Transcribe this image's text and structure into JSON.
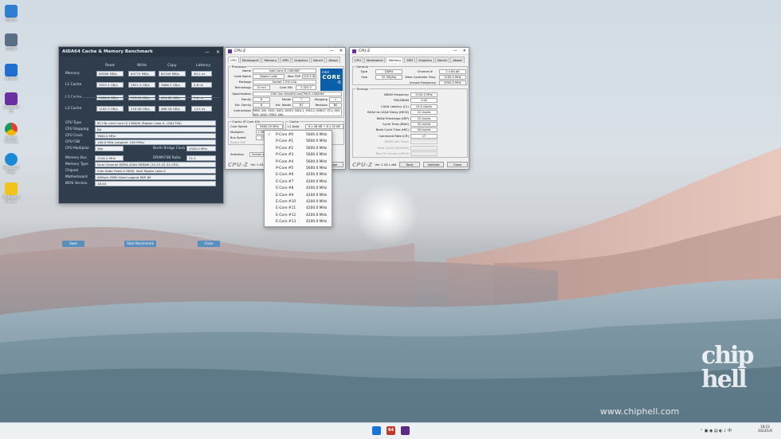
{
  "desktop": {
    "icons": [
      {
        "label": "回收站",
        "color": "#2f7fd1"
      },
      {
        "label": "此电脑",
        "color": "#5b6f86"
      },
      {
        "label": "AIDA64",
        "color": "#1e6fd0"
      },
      {
        "label": "CPU-Z 64位",
        "color": "#6a2fa0"
      },
      {
        "label": "Google Chrome",
        "color": "#e8a21f"
      },
      {
        "label": "Microsoft Edge",
        "color": "#1d8ad6"
      },
      {
        "label": "Thaiphoon Burner",
        "color": "#f0c419"
      }
    ]
  },
  "aida": {
    "title": "AIDA64 Cache & Memory Benchmark",
    "controls": {
      "minimize": "—",
      "close": "✕"
    },
    "cols": [
      "Read",
      "Write",
      "Copy",
      "Latency"
    ],
    "rows": [
      {
        "label": "Memory",
        "values": [
          "69280 MB/s",
          "64775 MB/s",
          "65190 MB/s",
          "90.2 ns"
        ]
      },
      {
        "label": "L1 Cache",
        "values": [
          "3933.4 GB/s",
          "2851.0 GB/s",
          "5686.5 GB/s",
          "0.8 ns"
        ]
      },
      {
        "label": "L2 Cache",
        "values": [
          "1060.0 GB/s",
          "393.20 GB/s",
          "694.82 GB/s",
          "3.6 ns"
        ]
      },
      {
        "label": "L3 Cache",
        "values": [
          "1165.3 GB/s",
          "516.08 GB/s",
          "668.56 GB/s",
          "14.5 ns"
        ]
      }
    ],
    "info": [
      {
        "label": "CPU Type",
        "value": "8C+8c Intel Core i5-13600K (Raptor Lake-S, LGA1700)"
      },
      {
        "label": "CPU Stepping",
        "value": "B0"
      },
      {
        "label": "CPU Clock",
        "value": "5600.0 MHz"
      },
      {
        "label": "CPU FSB",
        "value": "100.0 MHz (original: 100 MHz)"
      },
      {
        "label": "CPU Multiplier",
        "value": "56x",
        "extra_label": "North Bridge Clock",
        "extra_value": "4500.0 MHz"
      }
    ],
    "mem": [
      {
        "label": "Memory Bus",
        "value": "2100.0 MHz",
        "extra_label": "DRAM:FSB Ratio",
        "extra_value": "21:1"
      },
      {
        "label": "Memory Type",
        "value": "Dual Channel DDR4-4200 SDRAM (19-22-22-32 CR1)"
      },
      {
        "label": "Chipset",
        "value": "Intel Alder Point-S Z690, Intel Raptor Lake-S"
      },
      {
        "label": "Motherboard",
        "value": "ASRock Z690 Steel Legend WiFi 6E"
      },
      {
        "label": "BIOS Version",
        "value": "16.04"
      }
    ],
    "footer": "AIDA64 v6.80.6200 / BenchDLL 4.6.875.8-x64 (c) 1995-2022 FinalWire Ltd.",
    "buttons": {
      "save": "Save",
      "start": "Start Benchmark",
      "close": "Close"
    }
  },
  "cpuz1": {
    "title": "CPU-Z",
    "controls": {
      "minimize": "—",
      "close": "✕"
    },
    "tabs": [
      "CPU",
      "Mainboard",
      "Memory",
      "SPD",
      "Graphics",
      "Bench",
      "About"
    ],
    "processor_title": "Processor",
    "name_label": "Name",
    "name": "Intel Core i5 13600KF",
    "codename_label": "Code Name",
    "codename": "Raptor Lake",
    "maxtdp_label": "Max TDP",
    "maxtdp": "125.0 W",
    "package_label": "Package",
    "package": "Socket 1700 LGA",
    "tech_label": "Technology",
    "tech": "10 nm",
    "corevid_label": "Core VID",
    "corevid": "1.323 V",
    "spec_label": "Specification",
    "spec": "13th Gen Intel(R)Core(TM)i5-13600KF",
    "family_label": "Family",
    "family": "6",
    "model_label": "Model",
    "model": "7",
    "stepping_label": "Stepping",
    "stepping": "1",
    "extfam_label": "Ext. Family",
    "extfam": "6",
    "extmodel_label": "Ext. Model",
    "extmodel": "B7",
    "revision_label": "Revision",
    "revision": "B0",
    "instr_label": "Instructions",
    "instr": "MMX, SSE, SSE2, SSE3, SSSE3, SSE4.1, SSE4.2, EM64T, VT-x, AES, AVX, AVX2, FMA3, SHA",
    "logo": {
      "brand": "intel",
      "core": "CORE",
      "tier": "i5"
    },
    "clocks_title": "Clocks (P-Core #0)",
    "cache_title": "Cache",
    "corespeed_label": "Core Speed",
    "corespeed": "5600.00 MHz",
    "mult_label": "Multiplier",
    "mult": "x 56.0 (8 - 51.0)",
    "bus_label": "Bus Speed",
    "bus": "100.00 MHz",
    "fsb_label": "Rated FSB",
    "l1d_label": "L1 Data",
    "l1d": "6 x 48 KB + 8 x 32 KB",
    "sel_label": "Selection",
    "sel": "Socket #1",
    "version": "Ver. 2.03.1.x64",
    "tools": "Tools",
    "validate": "Validate",
    "close": "Close",
    "menu": [
      {
        "check": "✓",
        "name": "P-Core #0",
        "freq": "5600.0 MHz"
      },
      {
        "check": "",
        "name": "P-Core #1",
        "freq": "5600.0 MHz"
      },
      {
        "check": "",
        "name": "P-Core #2",
        "freq": "5600.0 MHz"
      },
      {
        "check": "",
        "name": "P-Core #3",
        "freq": "5600.0 MHz"
      },
      {
        "check": "",
        "name": "P-Core #4",
        "freq": "5600.0 MHz"
      },
      {
        "check": "",
        "name": "P-Core #5",
        "freq": "5600.0 MHz"
      },
      {
        "check": "",
        "name": "E-Core #6",
        "freq": "4200.0 MHz"
      },
      {
        "check": "",
        "name": "E-Core #7",
        "freq": "4200.0 MHz"
      },
      {
        "check": "",
        "name": "E-Core #8",
        "freq": "4200.0 MHz"
      },
      {
        "check": "",
        "name": "E-Core #9",
        "freq": "4200.0 MHz"
      },
      {
        "check": "",
        "name": "E-Core #10",
        "freq": "4200.0 MHz"
      },
      {
        "check": "",
        "name": "E-Core #11",
        "freq": "4200.0 MHz"
      },
      {
        "check": "",
        "name": "E-Core #12",
        "freq": "4200.0 MHz"
      },
      {
        "check": "",
        "name": "E-Core #13",
        "freq": "4200.0 MHz"
      }
    ]
  },
  "cpuz2": {
    "title": "CPU-Z",
    "controls": {
      "minimize": "—",
      "close": "✕"
    },
    "tabs": [
      "CPU",
      "Mainboard",
      "Memory",
      "SPD",
      "Graphics",
      "Bench",
      "About"
    ],
    "general_title": "General",
    "type_label": "Type",
    "type": "DDR4",
    "channel_label": "Channel #",
    "channel": "2 x 64-bit",
    "size_label": "Size",
    "size": "32 GBytes",
    "mcf_label": "Mem Controller Freq.",
    "mcf": "2100.0 MHz",
    "uncore_label": "Uncore Frequency",
    "uncore": "4500.0 MHz",
    "timings_title": "Timings",
    "timings": [
      {
        "label": "DRAM Frequency",
        "value": "2100.0 MHz"
      },
      {
        "label": "FSB:DRAM",
        "value": "1:42"
      },
      {
        "label": "CAS# Latency (CL)",
        "value": "19.0 clocks"
      },
      {
        "label": "RAS# to CAS# Delay (tRCD)",
        "value": "22 clocks"
      },
      {
        "label": "RAS# Precharge (tRP)",
        "value": "22 clocks"
      },
      {
        "label": "Cycle Time (tRAS)",
        "value": "32 clocks"
      },
      {
        "label": "Bank Cycle Time (tRC)",
        "value": "54 clocks"
      },
      {
        "label": "Command Rate (CR)",
        "value": "1T"
      },
      {
        "label": "DRAM Idle Timer",
        "value": ""
      },
      {
        "label": "Total CAS# (tRDRAM)",
        "value": ""
      },
      {
        "label": "Row To Column (tRCD)",
        "value": ""
      }
    ],
    "version": "Ver. 2.03.1.x64",
    "tools": "Tools",
    "validate": "Validate",
    "close": "Close"
  },
  "taskbar": {
    "apps": [
      {
        "name": "windows-start",
        "color": "#1a73d9"
      },
      {
        "name": "aida64",
        "color": "#c0392b",
        "text": "64"
      },
      {
        "name": "cpuz",
        "color": "#5b2a86"
      }
    ],
    "time": "18:23",
    "date": "2023/1/6"
  },
  "watermark": {
    "logo": "chip hell",
    "url": "www.chiphell.com"
  }
}
